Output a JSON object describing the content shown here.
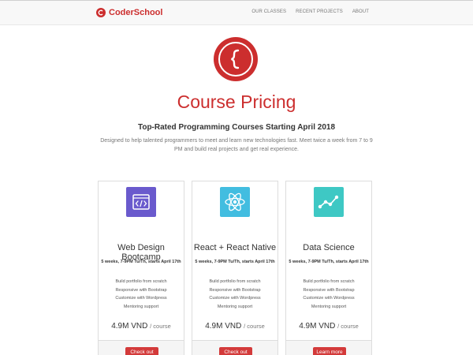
{
  "colors": {
    "brand": "#cc2e2e",
    "navbar_bg": "#f8f8f8",
    "button": "#d33a3a",
    "icon_web": "#6a5acd",
    "icon_react": "#42bde0",
    "icon_data": "#3ec8c4"
  },
  "navbar": {
    "brand_name": "CoderSchool",
    "links": [
      "OUR CLASSES",
      "RECENT PROJECTS",
      "ABOUT"
    ]
  },
  "hero": {
    "logo_icon": "curly-brace-icon",
    "title": "Course Pricing",
    "subtitle": "Top-Rated Programming Courses Starting April 2018",
    "intro": "Designed to help talented programmers to meet and learn new technologies fast. Meet twice a week from 7 to 9 PM and build real projects and get real experience."
  },
  "courses": [
    {
      "icon": "code-window-icon",
      "title": "Web Design Bootcamp",
      "schedule": "5 weeks, 7-9PM Tu/Th, starts April 17th",
      "features": [
        "Build portfolio from scratch",
        "Responsive with Bootstrap",
        "Customize with Wordpress",
        "Mentoring support"
      ],
      "price": "4.9M VND",
      "price_unit": "/ course",
      "button": "Check out"
    },
    {
      "icon": "react-atom-icon",
      "title": "React + React Native",
      "schedule": "5 weeks, 7-9PM Tu/Th, starts April 17th",
      "features": [
        "Build portfolio from scratch",
        "Responsive with Bootstrap",
        "Customize with Wordpress",
        "Mentoring support"
      ],
      "price": "4.9M VND",
      "price_unit": "/ course",
      "button": "Check out"
    },
    {
      "icon": "line-chart-icon",
      "title": "Data Science",
      "schedule": "5 weeks, 7-9PM Tu/Th, starts April 17th",
      "features": [
        "Build portfolio from scratch",
        "Responsive with Bootstrap",
        "Customize with Wordpress",
        "Mentoring support"
      ],
      "price": "4.9M VND",
      "price_unit": "/ course",
      "button": "Learn more"
    }
  ]
}
